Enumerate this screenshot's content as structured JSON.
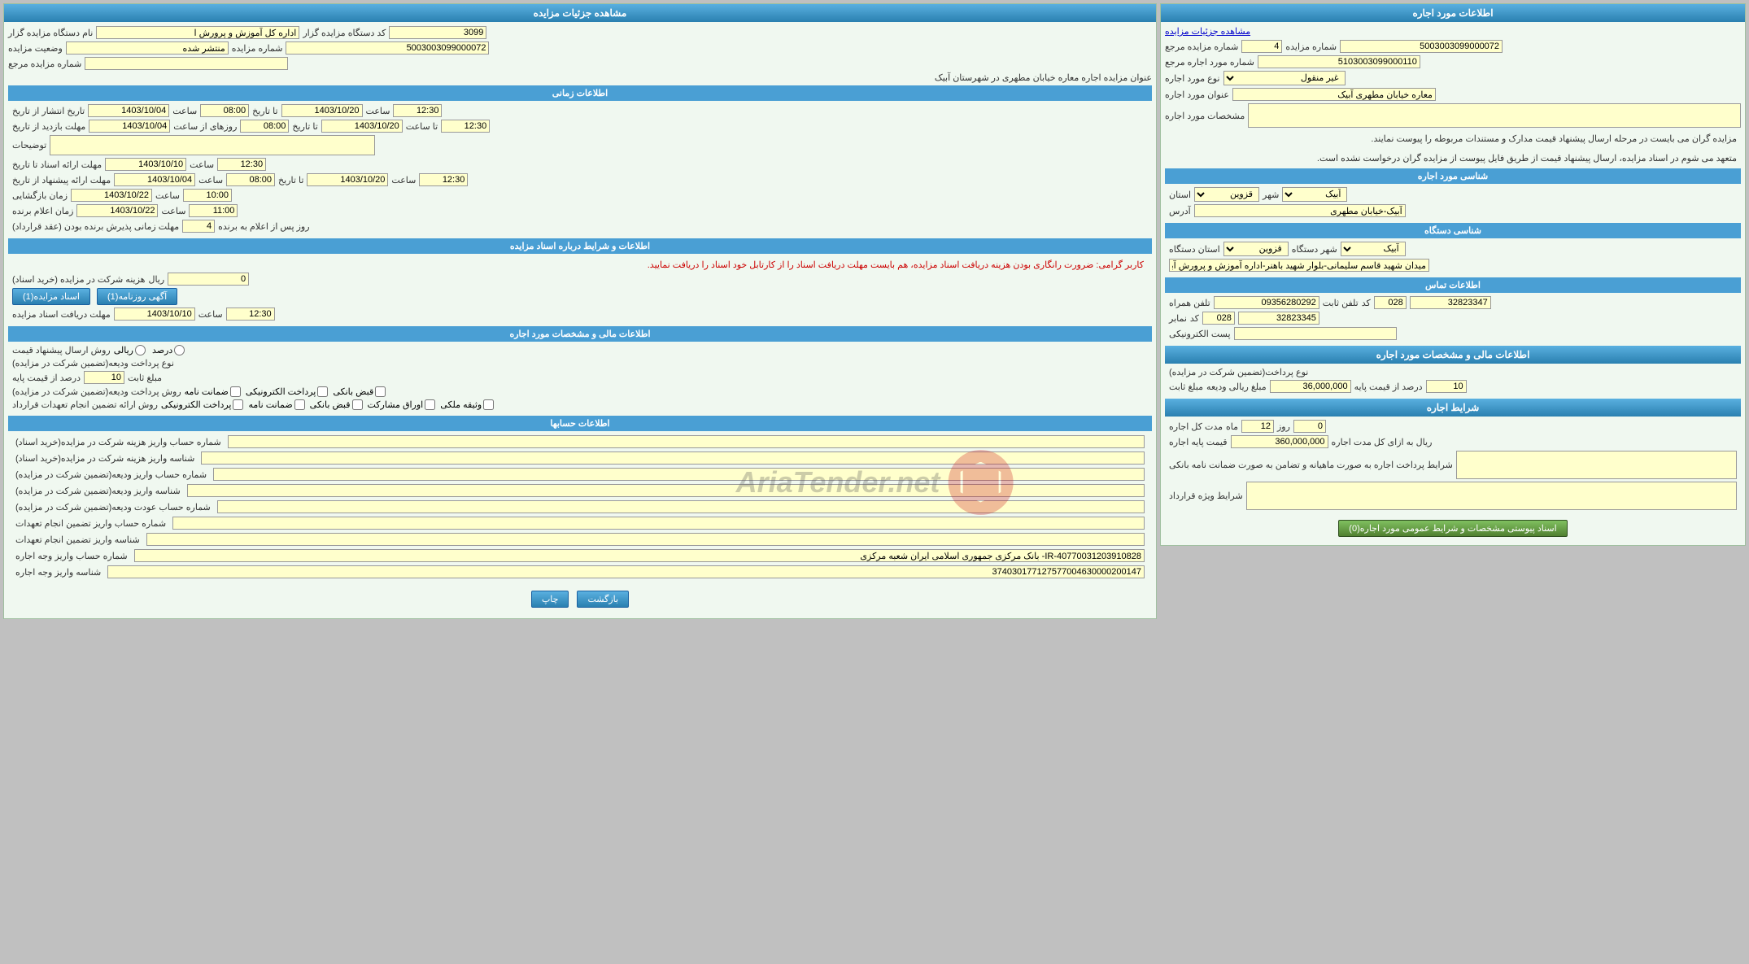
{
  "left": {
    "lease_info_header": "اطلاعات مورد اجاره",
    "link_view": "مشاهده جزئیات مزایده",
    "fields": {
      "auction_number_label": "شماره مزایده",
      "auction_number_ref_label": "شماره مزایده مرجع",
      "lease_ref_label": "شماره مورد اجاره مرجع",
      "lease_type_label": "نوع مورد اجاره",
      "lease_address_label": "عنوان مورد اجاره",
      "auction_number_value": "5003003099000072",
      "auction_number_ref_value": "4",
      "lease_ref_value": "5103003099000110",
      "lease_type_value": "غیر منقول",
      "lease_address_value": "معاره خیابان مطهری آبیک"
    },
    "specs_label": "مشخصات مورد اجاره",
    "specs_text1": "مزایده گران می بایست در مرحله ارسال پیشنهاد قیمت مدارک و مستندات مربوطه را پیوست نمایند.",
    "specs_text2": "متعهد می شوم در اسناد مزایده، ارسال پیشنهاد قیمت از طریق فایل پیوست از مزایده گران درخواست نشده است.",
    "property_id_header": "شناسی مورد اجاره",
    "province_label": "استان",
    "city_label": "شهر",
    "province_value": "قزوین",
    "city_value": "آبیک",
    "address_label": "آدرس",
    "address_value": "آبیک-خیابان مطهری",
    "device_id_header": "شناسی دستگاه",
    "device_province_label": "استان دستگاه",
    "device_city_label": "شهر دستگاه",
    "device_province_value": "قزوین",
    "device_city_value": "آبیک",
    "device_address_label": "آدرس دستگاه",
    "device_address_value": "میدان شهید قاسم سلیمانی-بلوار شهید باهنر-اداره آموزش و پرورش آبیک",
    "contact_header": "اطلاعات تماس",
    "phone_label": "تلفن ثابت",
    "phone_code_label": "کد",
    "phone_value": "32823347",
    "phone_code_value": "028",
    "mobile_label": "تلفن همراه",
    "mobile_value": "09356280292",
    "fax_label": "نمابر",
    "fax_code_label": "کد",
    "fax_value": "32823345",
    "fax_code_value": "028",
    "email_label": "پست الکترونیکی",
    "financial_header": "اطلاعات مالی و مشخصات مورد اجاره",
    "payment_type_label": "نوع پرداخت(تضمین شرکت در مزایده)",
    "base_price_percent_label": "درصد از قیمت پایه",
    "base_price_percent_value": "10",
    "riyal_value_label": "مبلغ ریالی ودیعه",
    "riyal_value_value": "36,000,000",
    "fixed_amount_label": "مبلغ ثابت",
    "lease_conditions_header": "شرایط اجاره",
    "lease_duration_label": "مدت کل اجاره",
    "duration_months": "12",
    "duration_days": "0",
    "months_label": "ماه",
    "days_label": "روز",
    "base_rent_label": "قیمت پایه اجاره",
    "base_rent_value": "360,000,000",
    "per_label": "ریال به ازای کل مدت اجاره",
    "payment_conditions_label": "شرایط پرداخت اجاره به صورت ماهیانه و تضامن به صورت ضمانت نامه بانکی",
    "special_conditions_label": "شرایط ویژه قرارداد",
    "btn_docs": "اسناد پیوستی مشخصات و شرایط عمومی مورد اجاره(0)"
  },
  "right": {
    "auction_details_header": "مشاهده جزئیات مزایده",
    "auction_code_label": "کد دستگاه مزایده گزار",
    "auction_code_value": "3099",
    "auction_number_label": "شماره مزایده",
    "auction_number_value": "5003003099000072",
    "auction_number_ref_label": "شماره مزایده مرجع",
    "auction_number_ref_value": "",
    "auction_org_label": "نام دستگاه مزایده گزار",
    "auction_org_value": "اداره کل آموزش و پرورش ا",
    "auction_status_label": "وضعیت مزایده",
    "auction_status_value": "منتشر شده",
    "auction_title_label": "عنوان مزایده اجاره معاره خیابان مطهری در شهرستان آبیک",
    "time_header": "اطلاعات زمانی",
    "pub_date_label": "تاریخ انتشار از تاریخ",
    "pub_date_from": "1403/10/04",
    "pub_date_from_time": "08:00",
    "pub_date_to": "1403/10/20",
    "pub_date_to_time": "12:30",
    "visit_date_label": "مهلت بازدید از تاریخ",
    "visit_date_from": "1403/10/04",
    "visit_date_from_time": "08:00",
    "visit_date_to": "1403/10/20",
    "visit_date_to_time": "12:30",
    "desc_label": "توضیحات",
    "doc_deadline_label": "مهلت ارائه اسناد تا تاریخ",
    "doc_deadline_date": "1403/10/10",
    "doc_deadline_time": "12:30",
    "offer_deadline_label": "مهلت ارائه پیشنهاد از تاریخ",
    "offer_deadline_date": "1403/10/04",
    "offer_deadline_time": "08:00",
    "offer_deadline_to": "1403/10/20",
    "offer_deadline_to_time": "12:30",
    "opening_date_label": "زمان بازگشایی",
    "opening_date": "1403/10/22",
    "opening_time": "10:00",
    "winner_announce_label": "زمان اعلام برنده",
    "winner_announce_date": "1403/10/22",
    "winner_announce_time": "11:00",
    "contract_days_label": "مهلت زمانی پذیرش برنده بودن (عقد قرارداد)",
    "contract_days_value": "4",
    "contract_days_unit": "روز پس از اعلام به برنده",
    "docs_header": "اطلاعات و شرایط درباره اسناد مزایده",
    "warning_text": "کاربر گرامی: ضرورت رانگاری بودن هزینه دریافت اسناد مزایده، هم بایست مهلت دریافت اسناد را از کارتابل خود اسناد را دریافت نمایید.",
    "doc_fee_label": "هزینه شرکت در مزایده (خرید اسناد)",
    "doc_fee_value": "0",
    "doc_fee_unit": "ریال",
    "btn_auction_doc": "اسناد مزایده(1)",
    "btn_ad_doc": "آگهی روزنامه(1)",
    "doc_deadline2_label": "مهلت دریافت اسناد مزایده",
    "doc_deadline2_date": "1403/10/10",
    "doc_deadline2_time": "12:30",
    "financial2_header": "اطلاعات مالی و مشخصات مورد اجاره",
    "send_method_label": "روش ارسال پیشنهاد قیمت",
    "riyal_radio": "ریالی",
    "percent_radio": "درصد",
    "payment_type2_label": "نوع پرداخت ودیعه(تضمین شرکت در مزایده)",
    "base_price_percent2_label": "درصد از قیمت پایه",
    "base_price_percent2_value": "10",
    "fixed_amount2_label": "مبلغ ثابت",
    "payment_method_label": "روش پرداخت ودیعه(تضمین شرکت در مزایده)",
    "check_electronic": "پرداخت الکترونیکی",
    "check_guarantee": "ضمانت نامه",
    "check_bank": "قبض بانکی",
    "contract_method_label": "روش ارائه تضمین انجام تعهدات قرارداد",
    "check_electronic2": "پرداخت الکترونیکی",
    "check_guarantee2": "ضمانت نامه",
    "check_bank2": "قبض بانکی",
    "check_shares": "اوراق مشارکت",
    "check_property": "وثیقه ملکی",
    "accounts_header": "اطلاعات حسابها",
    "acc1_label": "شماره حساب واریز هزینه شرکت در مزایده(خرید اسناد)",
    "acc1_value": "",
    "acc2_label": "شناسه واریز هزینه شرکت در مزایده(خرید اسناد)",
    "acc2_value": "",
    "acc3_label": "شماره حساب واریز ودیعه(تضمین شرکت در مزایده)",
    "acc3_value": "",
    "acc4_label": "شناسه واریز ودیعه(تضمین شرکت در مزایده)",
    "acc4_value": "",
    "acc5_label": "شماره حساب عودت ودیعه(تضمین شرکت در مزایده)",
    "acc5_value": "",
    "acc6_label": "شماره حساب واریز تضمین انجام تعهدات",
    "acc6_value": "",
    "acc7_label": "شناسه واریز تضمین انجام تعهدات",
    "acc7_value": "",
    "acc8_label": "شماره حساب واریز وجه اجاره",
    "acc8_value": "IR-40770031203910828- بانک مرکزی جمهوری اسلامی ایران شعبه مرکزی",
    "acc9_label": "شناسه واریز وجه اجاره",
    "acc9_value": "374030177127577004630000200147",
    "btn_print": "چاپ",
    "btn_back": "بازگشت"
  }
}
